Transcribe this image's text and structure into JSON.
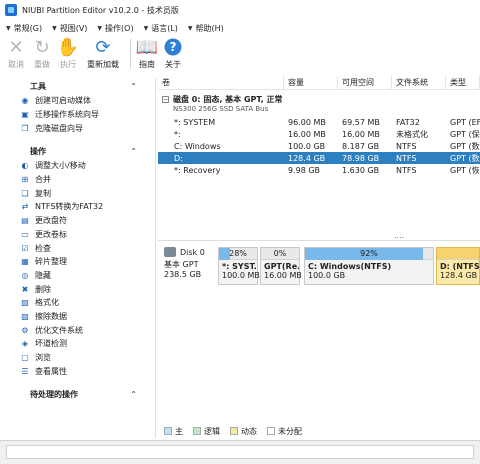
{
  "window": {
    "title": "NIUBI Partition Editor v10.2.0 - 技术员版"
  },
  "menu": [
    {
      "label": "常规(G)"
    },
    {
      "label": "视图(V)"
    },
    {
      "label": "操作(O)"
    },
    {
      "label": "语言(L)"
    },
    {
      "label": "帮助(H)"
    }
  ],
  "toolbar": {
    "cancel": "取消",
    "redo": "重做",
    "apply": "执行",
    "reload": "重新加载",
    "guide": "指南",
    "about": "关于"
  },
  "sidebar": {
    "tools_title": "工具",
    "tools": [
      {
        "label": "创建可启动媒体",
        "icon": "bootable-media-icon"
      },
      {
        "label": "迁移操作系统向导",
        "icon": "migrate-os-icon"
      },
      {
        "label": "克隆磁盘向导",
        "icon": "clone-disk-icon"
      }
    ],
    "ops_title": "操作",
    "ops": [
      {
        "label": "调整大小/移动",
        "icon": "resize-icon"
      },
      {
        "label": "合并",
        "icon": "merge-icon"
      },
      {
        "label": "复制",
        "icon": "copy-icon"
      },
      {
        "label": "NTFS转换为FAT32",
        "icon": "convert-icon"
      },
      {
        "label": "更改盘符",
        "icon": "drive-letter-icon"
      },
      {
        "label": "更改卷标",
        "icon": "label-icon"
      },
      {
        "label": "检查",
        "icon": "check-icon"
      },
      {
        "label": "碎片整理",
        "icon": "defrag-icon"
      },
      {
        "label": "隐藏",
        "icon": "hide-icon"
      },
      {
        "label": "删除",
        "icon": "delete-icon"
      },
      {
        "label": "格式化",
        "icon": "format-icon"
      },
      {
        "label": "擦除数据",
        "icon": "wipe-icon"
      },
      {
        "label": "优化文件系统",
        "icon": "optimize-icon"
      },
      {
        "label": "坏道检测",
        "icon": "bad-sector-icon"
      },
      {
        "label": "浏览",
        "icon": "explore-icon"
      },
      {
        "label": "查看属性",
        "icon": "properties-icon"
      }
    ],
    "pending_title": "待处理的操作"
  },
  "table": {
    "headers": [
      "卷",
      "容量",
      "可用空间",
      "文件系统",
      "类型"
    ],
    "disk": {
      "title": "磁盘 0: 固态, 基本 GPT, 正常",
      "model": "NS300 256G SSD SATA Bus"
    },
    "rows": [
      {
        "volume": "*: SYSTEM",
        "capacity": "96.00 MB",
        "free": "69.57 MB",
        "fs": "FAT32",
        "type": "GPT (EFI"
      },
      {
        "volume": "*:",
        "capacity": "16.00 MB",
        "free": "16.00 MB",
        "fs": "未格式化",
        "type": "GPT (保"
      },
      {
        "volume": "C: Windows",
        "capacity": "100.0 GB",
        "free": "8.187 GB",
        "fs": "NTFS",
        "type": "GPT (数"
      },
      {
        "volume": "D:",
        "capacity": "128.4 GB",
        "free": "78.98 GB",
        "fs": "NTFS",
        "type": "GPT (数"
      },
      {
        "volume": "*: Recovery",
        "capacity": "9.98 GB",
        "free": "1.630 GB",
        "fs": "NTFS",
        "type": "GPT (恢"
      }
    ],
    "ellipsis": "...."
  },
  "diskmap": {
    "name": "Disk 0",
    "type": "基本 GPT",
    "size": "238.5 GB",
    "partitions": [
      {
        "pct": "28%",
        "fill": 0.28,
        "name": "*: SYST...",
        "size": "100.0 MB"
      },
      {
        "pct": "0%",
        "fill": 0.0,
        "name": "GPT(Re...",
        "size": "16.00 MB"
      },
      {
        "pct": "92%",
        "fill": 0.92,
        "name": "C: Windows(NTFS)",
        "size": "100.0 GB"
      },
      {
        "pct": "",
        "fill": 0.0,
        "name": "D: (NTFS)",
        "size": "128.4 GB"
      }
    ]
  },
  "legend": [
    {
      "label": "主",
      "color": "#bfe0f7"
    },
    {
      "label": "逻辑",
      "color": "#bfe8c9"
    },
    {
      "label": "动态",
      "color": "#f3e8a2"
    },
    {
      "label": "未分配",
      "color": "#ffffff"
    }
  ]
}
